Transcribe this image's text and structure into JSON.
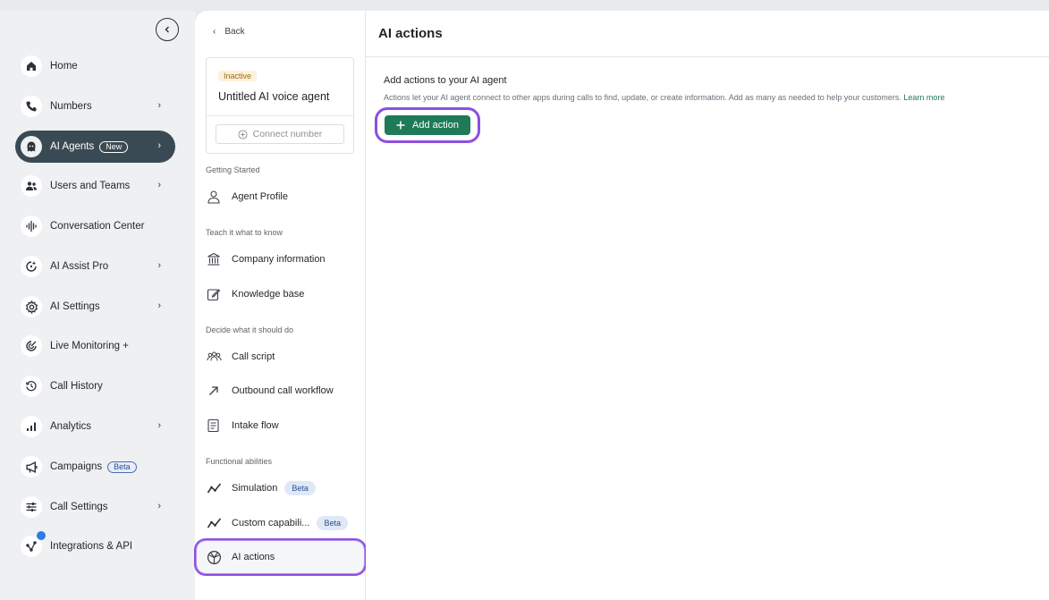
{
  "nav": {
    "collapse_icon": "chevron-left-icon",
    "items": [
      {
        "label": "Home",
        "icon": "home-icon",
        "chevron": false
      },
      {
        "label": "Numbers",
        "icon": "phone-icon",
        "chevron": true
      },
      {
        "label": "AI Agents",
        "icon": "ai-agent-icon",
        "chevron": true,
        "badge": "New",
        "active": true
      },
      {
        "label": "Users and Teams",
        "icon": "users-icon",
        "chevron": true
      },
      {
        "label": "Conversation Center",
        "icon": "waveform-icon",
        "chevron": false
      },
      {
        "label": "AI Assist Pro",
        "icon": "ai-assist-icon",
        "chevron": true
      },
      {
        "label": "AI Settings",
        "icon": "gear-icon",
        "chevron": true
      },
      {
        "label": "Live Monitoring +",
        "icon": "live-monitor-icon",
        "chevron": false
      },
      {
        "label": "Call History",
        "icon": "history-icon",
        "chevron": false
      },
      {
        "label": "Analytics",
        "icon": "bar-chart-icon",
        "chevron": true
      },
      {
        "label": "Campaigns",
        "icon": "megaphone-icon",
        "chevron": false,
        "badge": "Beta"
      },
      {
        "label": "Call Settings",
        "icon": "sliders-icon",
        "chevron": true
      },
      {
        "label": "Integrations & API",
        "icon": "integrations-icon",
        "chevron": false,
        "notification": true
      }
    ]
  },
  "middle": {
    "back_label": "Back",
    "agent": {
      "status": "Inactive",
      "name": "Untitled AI voice agent",
      "connect_label": "Connect number"
    },
    "sections": {
      "getting_started": "Getting Started",
      "teach": "Teach it what to know",
      "decide": "Decide what it should do",
      "functional": "Functional abilities"
    },
    "items": {
      "agent_profile": "Agent Profile",
      "company_information": "Company information",
      "knowledge_base": "Knowledge base",
      "call_script": "Call script",
      "outbound_call_workflow": "Outbound call workflow",
      "intake_flow": "Intake flow",
      "simulation": "Simulation",
      "simulation_badge": "Beta",
      "custom_capabilities": "Custom capabili...",
      "custom_badge": "Beta",
      "ai_actions": "AI actions"
    }
  },
  "main": {
    "title": "AI actions",
    "subtitle": "Add actions to your AI agent",
    "description": "Actions let your AI agent connect to other apps during calls to find, update, or create information. Add as many as needed to help your customers.",
    "learn_more": "Learn more",
    "add_action_label": "Add action"
  },
  "colors": {
    "active_nav": "#3a4a54",
    "highlight": "#8d4fe0",
    "primary_button": "#1f7a57",
    "link": "#217a5b"
  }
}
